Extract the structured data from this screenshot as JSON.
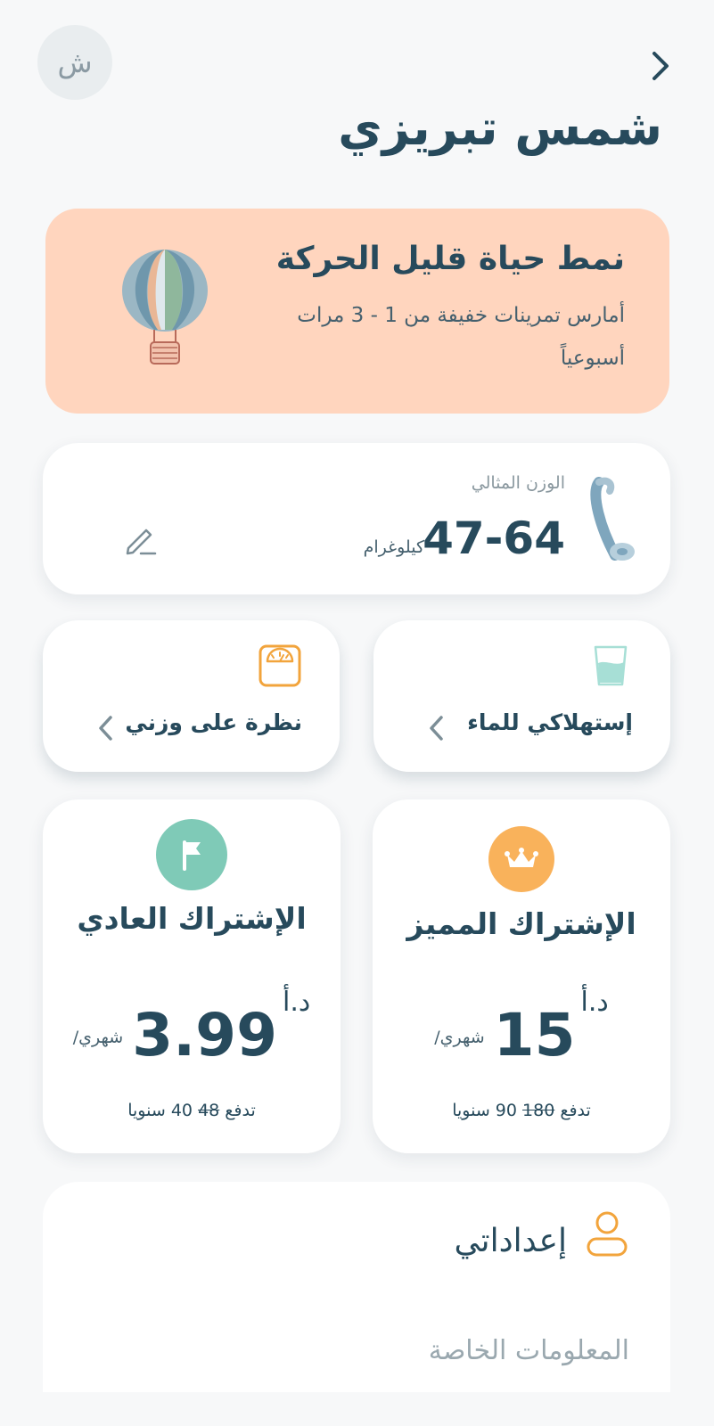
{
  "header": {
    "avatar_initial": "ش",
    "user_name": "شمس تبريزي"
  },
  "activity": {
    "title": "نمط حياة قليل الحركة",
    "description": "أمارس تمرينات خفيفة من 1 - 3 مرات أسبوعياً",
    "icon": "hot-air-balloon-icon"
  },
  "ideal_weight": {
    "label": "الوزن المثالي",
    "value": "47-64",
    "unit": "كيلوغرام",
    "icon": "measuring-tape-icon"
  },
  "tiles": {
    "water": {
      "label": "إستهلاكي للماء",
      "icon": "water-glass-icon"
    },
    "weight": {
      "label": "نظرة على وزني",
      "icon": "scale-icon"
    }
  },
  "plans": {
    "premium": {
      "name": "الإشتراك المميز",
      "currency": "د.أ",
      "amount": "15",
      "period": "/شهري",
      "yearly_prefix": "تدفع",
      "yearly_old": "180",
      "yearly_new": "90 سنويا",
      "color": "#f9b25b",
      "icon": "crown-icon"
    },
    "regular": {
      "name": "الإشتراك العادي",
      "currency": "د.أ",
      "amount": "3.99",
      "period": "/شهري",
      "yearly_prefix": "تدفع",
      "yearly_old": "48",
      "yearly_new": "40 سنويا",
      "color": "#7fcab7",
      "icon": "flag-icon"
    }
  },
  "settings": {
    "title": "إعداداتي",
    "first_item": "المعلومات الخاصة",
    "icon": "user-icon"
  }
}
